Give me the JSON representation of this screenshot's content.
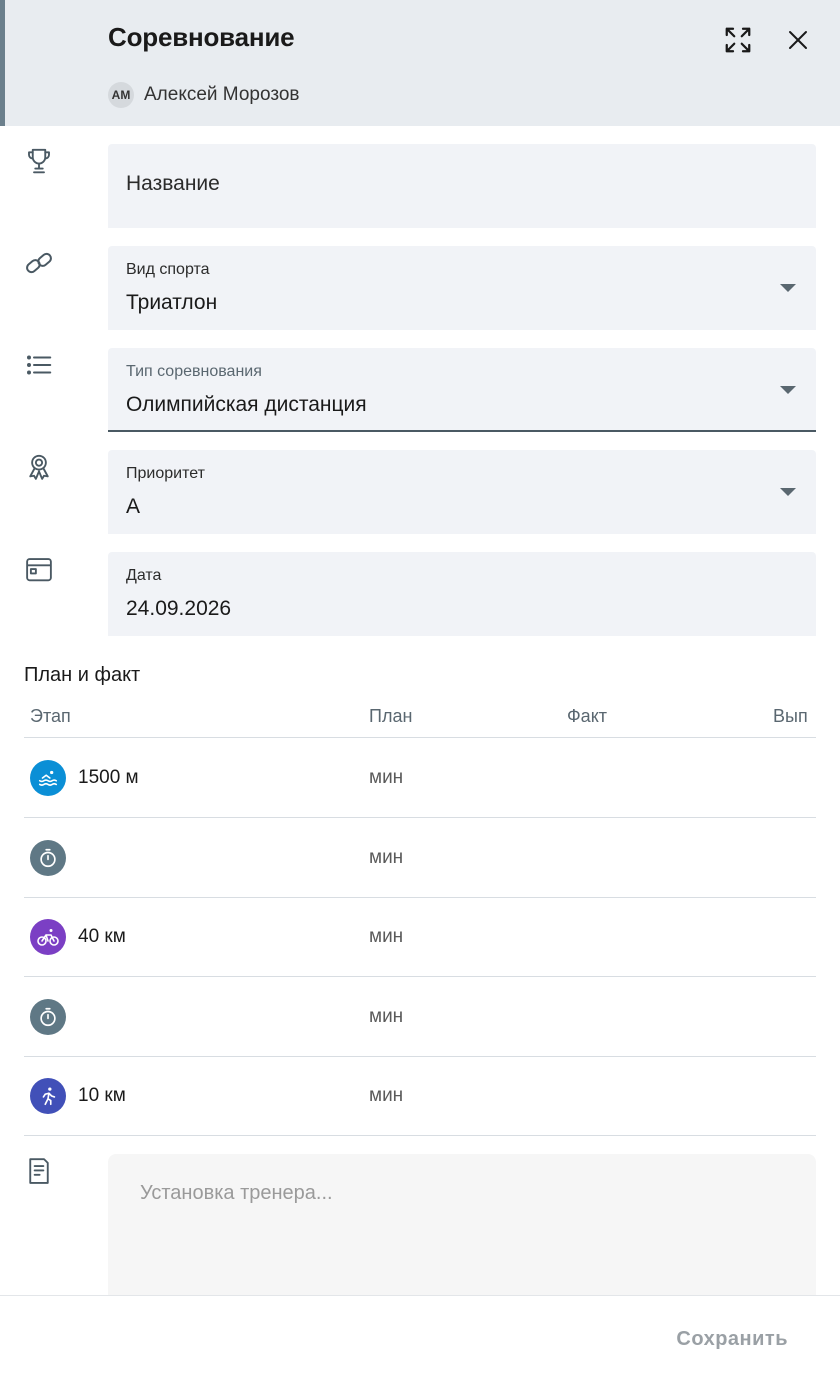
{
  "header": {
    "title": "Соревнование",
    "author_initials": "АМ",
    "author_name": "Алексей Морозов"
  },
  "fields": {
    "name": {
      "placeholder": "Название"
    },
    "sport": {
      "label": "Вид спорта",
      "value": "Триатлон"
    },
    "type": {
      "label": "Тип соревнования",
      "value": "Олимпийская дистанция"
    },
    "priority": {
      "label": "Приоритет",
      "value": "A"
    },
    "date": {
      "label": "Дата",
      "value": "24.09.2026"
    }
  },
  "plan": {
    "title": "План и факт",
    "columns": [
      "Этап",
      "План",
      "Факт",
      "Вып"
    ],
    "stages": [
      {
        "name": "1500 м",
        "icon": "swim-icon",
        "color": "#0b8fd6",
        "unit": "мин"
      },
      {
        "name": "",
        "icon": "stopwatch-icon",
        "color": "#5f7885",
        "unit": "мин"
      },
      {
        "name": "40 км",
        "icon": "bike-icon",
        "color": "#7b3fc4",
        "unit": "мин"
      },
      {
        "name": "",
        "icon": "stopwatch-icon",
        "color": "#5f7885",
        "unit": "мин"
      },
      {
        "name": "10 км",
        "icon": "run-icon",
        "color": "#4150b8",
        "unit": "мин"
      }
    ]
  },
  "notes": {
    "placeholder": "Установка тренера..."
  },
  "footer": {
    "save_label": "Сохранить"
  }
}
